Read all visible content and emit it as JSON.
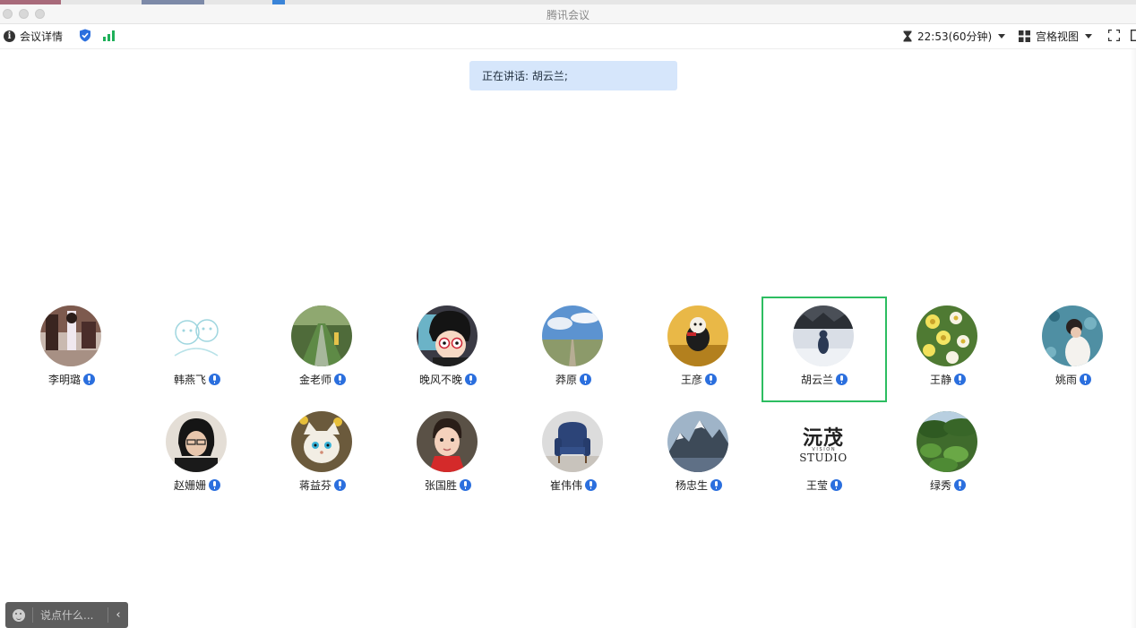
{
  "window": {
    "title": "腾讯会议"
  },
  "toolbar": {
    "meeting_info_label": "会议详情",
    "timer": "22:53(60分钟)",
    "view_label": "宫格视图"
  },
  "speaking": {
    "text": "正在讲话: 胡云兰;"
  },
  "participants_row1": [
    {
      "name": "李明璐",
      "mic": "muted",
      "active": false
    },
    {
      "name": "韩燕飞",
      "mic": "muted",
      "active": false
    },
    {
      "name": "金老师",
      "mic": "on",
      "active": false
    },
    {
      "name": "晚风不晚",
      "mic": "muted",
      "active": false
    },
    {
      "name": "莽原",
      "mic": "muted",
      "active": false
    },
    {
      "name": "王彦",
      "mic": "muted",
      "active": false
    },
    {
      "name": "胡云兰",
      "mic": "on",
      "active": true
    },
    {
      "name": "王静",
      "mic": "muted",
      "active": false
    },
    {
      "name": "姚雨",
      "mic": "muted",
      "active": false
    }
  ],
  "participants_row2": [
    {
      "name": "赵姗姗",
      "mic": "muted"
    },
    {
      "name": "蒋益芬",
      "mic": "muted"
    },
    {
      "name": "张国胜",
      "mic": "muted"
    },
    {
      "name": "崔伟伟",
      "mic": "muted"
    },
    {
      "name": "杨忠生",
      "mic": "muted"
    },
    {
      "name": "王莹",
      "mic": "muted",
      "logo_text_top": "沅茂",
      "logo_text_mid": "V I S I O N",
      "logo_text_bottom": "STUDIO"
    },
    {
      "name": "绿秀",
      "mic": "muted"
    }
  ],
  "chat": {
    "placeholder": "说点什么..."
  },
  "colors": {
    "active_border": "#2dbd61",
    "mic_blue": "#2b6fde",
    "banner_bg": "#d6e6fb"
  }
}
